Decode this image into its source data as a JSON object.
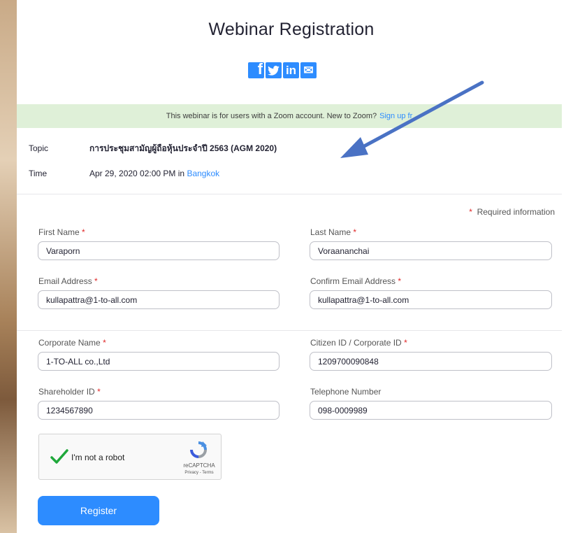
{
  "page": {
    "title": "Webinar Registration",
    "social_icons": [
      "facebook-icon",
      "twitter-icon",
      "linkedin-icon",
      "email-icon"
    ],
    "social_glyphs": {
      "facebook": "f",
      "linkedin": "in",
      "email": "✉"
    }
  },
  "banner": {
    "text": "This webinar is for users with a Zoom account. New to Zoom?",
    "link_text": "Sign up fr"
  },
  "webinar": {
    "topic_label": "Topic",
    "topic_value": "การประชุมสามัญผู้ถือหุ้นประจำปี 2563 (AGM 2020)",
    "time_label": "Time",
    "time_value": "Apr 29, 2020 02:00 PM in",
    "time_zone": "Bangkok"
  },
  "form": {
    "required_note": "Required information",
    "star": "*",
    "first_name": {
      "label": "First Name",
      "value": "Varaporn"
    },
    "last_name": {
      "label": "Last Name",
      "value": "Voraananchai"
    },
    "email": {
      "label": "Email Address",
      "value": "kullapattra@1-to-all.com"
    },
    "confirm_email": {
      "label": "Confirm Email Address",
      "value": "kullapattra@1-to-all.com"
    },
    "corporate_name": {
      "label": "Corporate Name",
      "value": "1-TO-ALL co.,Ltd"
    },
    "citizen_id": {
      "label": "Citizen ID / Corporate ID",
      "value": "1209700090848"
    },
    "shareholder_id": {
      "label": "Shareholder ID",
      "value": "1234567890"
    },
    "telephone": {
      "label": "Telephone Number",
      "value": "098-0009989"
    }
  },
  "captcha": {
    "label": "I'm not a robot",
    "brand": "reCAPTCHA",
    "links": "Privacy - Terms",
    "checked": true
  },
  "register_label": "Register",
  "colors": {
    "accent": "#2d8cff",
    "banner_bg": "#dff0d8",
    "required_star": "#e02828",
    "check_green": "#1fa83b"
  }
}
